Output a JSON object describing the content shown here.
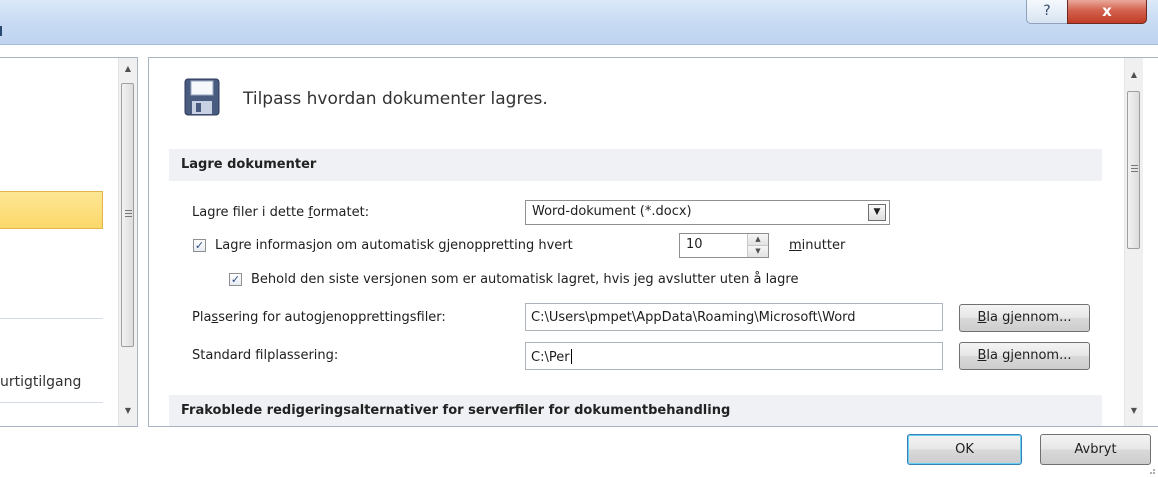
{
  "window": {
    "help_glyph": "?",
    "close_glyph": "x"
  },
  "left_pane": {
    "partial_item_label": "urtigtilgang"
  },
  "right_pane": {
    "header": {
      "icon": "save-disk-icon",
      "text": "Tilpass hvordan dokumenter lagres."
    },
    "section_save": {
      "title": "Lagre dokumenter"
    },
    "format_row": {
      "label": "Lagre filer i dette formatet:",
      "value": "Word-dokument (*.docx)"
    },
    "autorecover_row": {
      "checked": true,
      "label": "Lagre informasjon om automatisk gjenoppretting hvert",
      "minutes_value": "10",
      "minutes_label": "minutter"
    },
    "keep_version_row": {
      "checked": true,
      "label": "Behold den siste versjonen som er automatisk lagret, hvis jeg avslutter uten å lagre"
    },
    "autorecover_location": {
      "label": "Plassering for autogjenopprettingsfiler:",
      "value": "C:\\Users\\pmpet\\AppData\\Roaming\\Microsoft\\Word",
      "browse_label": "Bla gjennom..."
    },
    "default_location": {
      "label": "Standard filplassering:",
      "value": "C:\\Per",
      "browse_label": "Bla gjennom..."
    },
    "section_offline": {
      "title": "Frakoblede redigeringsalternativer for serverfiler for dokumentbehandling"
    }
  },
  "footer": {
    "ok_label": "OK",
    "cancel_label": "Avbryt"
  },
  "colors": {
    "selection": "#fcd869",
    "titlebar": "#c6daf3",
    "close_button": "#c03c25",
    "section_bg": "#eff1f4",
    "check_mark": "#2d4e8a"
  }
}
